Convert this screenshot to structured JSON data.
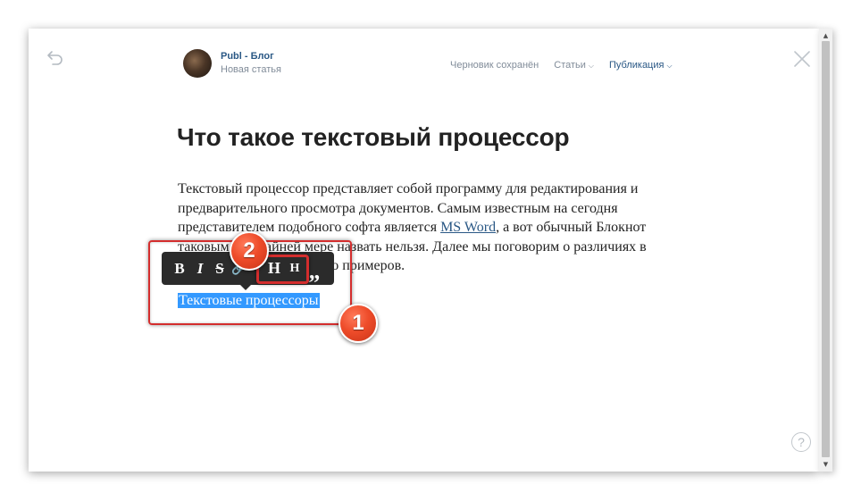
{
  "header": {
    "author_name": "Publ - Блог",
    "author_sub": "Новая статья",
    "nav": {
      "draft_status": "Черновик сохранён",
      "articles": "Статьи",
      "publish": "Публикация"
    }
  },
  "article": {
    "title": "Что такое текстовый процессор",
    "paragraph_before_link": "Текстовый процессор представляет собой программу для редактирования и предварительного просмотра документов. Самым известным на сегодня представителем подобного софта является ",
    "link_text": "MS Word",
    "paragraph_after_link": ", а вот обычный Блокнот таковым по крайней мере назвать нельзя. Далее мы поговорим о различиях в работе, приведя несколько примеров.",
    "selected_line": "Текстовые процессоры"
  },
  "toolbar": {
    "bold": "B",
    "italic": "I",
    "strike": "S",
    "link": "🔗",
    "heading_large": "H",
    "heading_small": "H",
    "quote": "„"
  },
  "annotations": {
    "badge_1": "1",
    "badge_2": "2"
  },
  "help": "?",
  "colors": {
    "accent": "#2a5885",
    "muted": "#818c99",
    "selection": "#3399ff",
    "highlight_red": "#d42d2d",
    "badge_orange": "#ee4c2a",
    "toolbar_bg": "#2b2b2b"
  },
  "icons": {
    "undo": "undo-icon",
    "close": "close-icon",
    "help": "help-icon",
    "chevron": "chevron-down-icon"
  }
}
